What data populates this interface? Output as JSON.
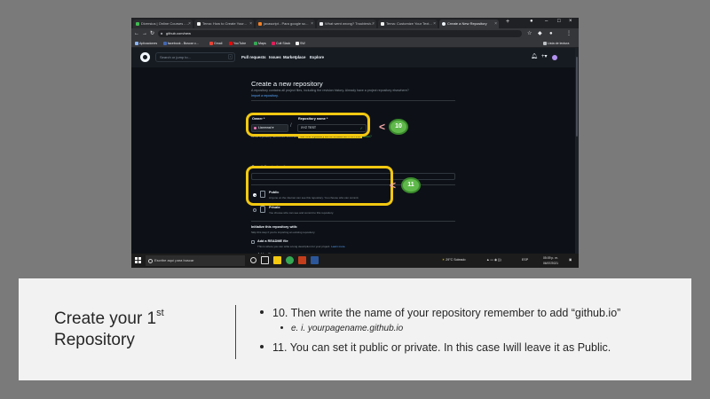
{
  "browser": {
    "tabs": [
      {
        "label": "Diversius | Online Courses - ..."
      },
      {
        "label": "Tema: How to Create Your..."
      },
      {
        "label": "javascript - Para google sc..."
      },
      {
        "label": "What went wrong? Troublesh..."
      },
      {
        "label": "Tema: Customize Your Text..."
      },
      {
        "label": "Create a New Repository"
      }
    ],
    "url": "github.com/new",
    "bookmarks": [
      "Aplicaciones",
      "facebook - Buscar c...",
      "Gmail",
      "YouTube",
      "Maps",
      "Cult Slack",
      "SW"
    ],
    "reading_list": "Lista de lectura"
  },
  "github": {
    "search_placeholder": "Search or jump to...",
    "search_key": "/",
    "nav": [
      "Pull requests",
      "Issues",
      "Marketplace",
      "Explore"
    ],
    "page_title": "Create a new repository",
    "subtitle": "A repository contains all project files, including the revision history. Already have a project repository elsewhere?",
    "import_link": "Import a repository.",
    "owner_label": "Owner *",
    "repo_label": "Repository name *",
    "owner_value": "Lianmnal",
    "repo_value": "XYZ TEST",
    "name_hint": "Great repository names are short and memorable. Need inspiration? How about",
    "name_hint_available": "Your new repository will be created as XYZ-TEST.",
    "name_hint_suggestion": "stunning-disco?",
    "description_label": "Description",
    "description_optional": "(optional)",
    "public_title": "Public",
    "public_desc": "Anyone on the internet can see this repository. You choose who can commit.",
    "private_title": "Private",
    "private_desc": "You choose who can see and commit to this repository.",
    "init_title": "Initialize this repository with:",
    "init_desc": "Skip this step if you're importing an existing repository.",
    "readme_title": "Add a README file",
    "readme_desc": "This is where you can write a long description for your project.",
    "readme_link": "Learn more.",
    "gitignore_title": "Add .gitignore",
    "gitignore_desc": "Choose which files not to track from a list of templates.",
    "gitignore_link": "Learn more.",
    "license_title": "Choose a license"
  },
  "annotations": {
    "callout_10": "10",
    "callout_11": "11",
    "accent_color": "#f2c811",
    "callout_color": "#5fb94b"
  },
  "taskbar": {
    "search_placeholder": "Escribe aquí para buscar",
    "weather": "29°C Soleado",
    "lang": "ESP",
    "time": "05:09 p. m.",
    "date": "06/07/2021"
  },
  "slide": {
    "title_line1": "Create your 1",
    "title_sup": "st",
    "title_line2": "Repository",
    "bullet_1": "10. Then write the name of your repository remember to add “github.io”",
    "sub_bullet_1": "e. i. yourpagename.github.io",
    "bullet_2": "11. You can set it public or private. In this case  Iwill leave it as Public."
  }
}
